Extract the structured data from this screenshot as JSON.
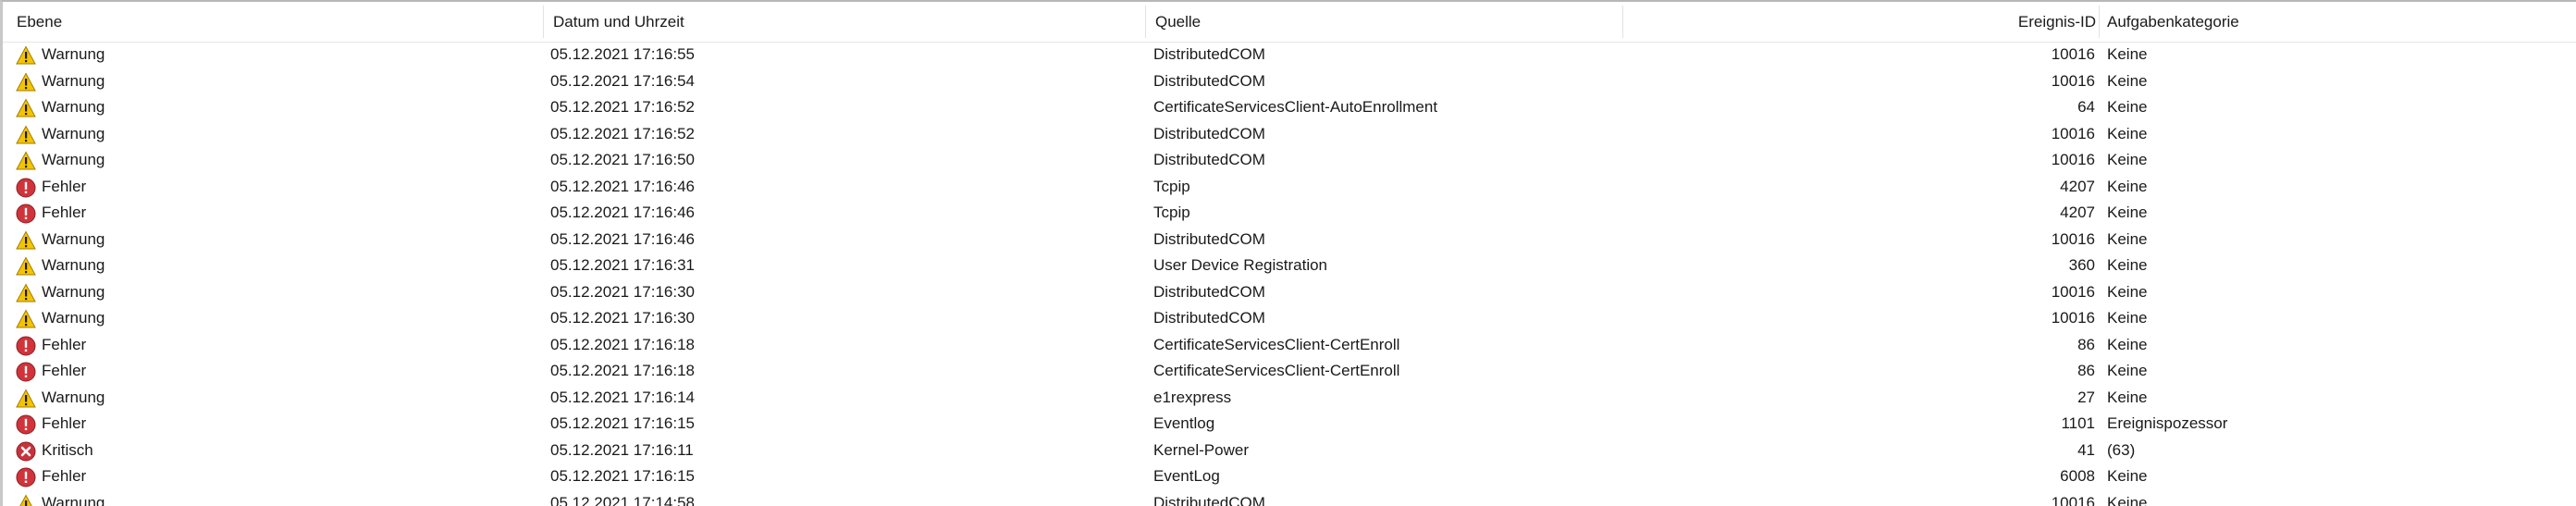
{
  "columns": {
    "level": "Ebene",
    "datetime": "Datum und Uhrzeit",
    "source": "Quelle",
    "event_id": "Ereignis-ID",
    "category": "Aufgabenkategorie"
  },
  "rows": [
    {
      "level": "Warnung",
      "icon": "warning-icon",
      "datetime": "05.12.2021 17:16:55",
      "source": "DistributedCOM",
      "event_id": "10016",
      "category": "Keine"
    },
    {
      "level": "Warnung",
      "icon": "warning-icon",
      "datetime": "05.12.2021 17:16:54",
      "source": "DistributedCOM",
      "event_id": "10016",
      "category": "Keine"
    },
    {
      "level": "Warnung",
      "icon": "warning-icon",
      "datetime": "05.12.2021 17:16:52",
      "source": "CertificateServicesClient-AutoEnrollment",
      "event_id": "64",
      "category": "Keine"
    },
    {
      "level": "Warnung",
      "icon": "warning-icon",
      "datetime": "05.12.2021 17:16:52",
      "source": "DistributedCOM",
      "event_id": "10016",
      "category": "Keine"
    },
    {
      "level": "Warnung",
      "icon": "warning-icon",
      "datetime": "05.12.2021 17:16:50",
      "source": "DistributedCOM",
      "event_id": "10016",
      "category": "Keine"
    },
    {
      "level": "Fehler",
      "icon": "error-icon",
      "datetime": "05.12.2021 17:16:46",
      "source": "Tcpip",
      "event_id": "4207",
      "category": "Keine"
    },
    {
      "level": "Fehler",
      "icon": "error-icon",
      "datetime": "05.12.2021 17:16:46",
      "source": "Tcpip",
      "event_id": "4207",
      "category": "Keine"
    },
    {
      "level": "Warnung",
      "icon": "warning-icon",
      "datetime": "05.12.2021 17:16:46",
      "source": "DistributedCOM",
      "event_id": "10016",
      "category": "Keine"
    },
    {
      "level": "Warnung",
      "icon": "warning-icon",
      "datetime": "05.12.2021 17:16:31",
      "source": "User Device Registration",
      "event_id": "360",
      "category": "Keine"
    },
    {
      "level": "Warnung",
      "icon": "warning-icon",
      "datetime": "05.12.2021 17:16:30",
      "source": "DistributedCOM",
      "event_id": "10016",
      "category": "Keine"
    },
    {
      "level": "Warnung",
      "icon": "warning-icon",
      "datetime": "05.12.2021 17:16:30",
      "source": "DistributedCOM",
      "event_id": "10016",
      "category": "Keine"
    },
    {
      "level": "Fehler",
      "icon": "error-icon",
      "datetime": "05.12.2021 17:16:18",
      "source": "CertificateServicesClient-CertEnroll",
      "event_id": "86",
      "category": "Keine"
    },
    {
      "level": "Fehler",
      "icon": "error-icon",
      "datetime": "05.12.2021 17:16:18",
      "source": "CertificateServicesClient-CertEnroll",
      "event_id": "86",
      "category": "Keine"
    },
    {
      "level": "Warnung",
      "icon": "warning-icon",
      "datetime": "05.12.2021 17:16:14",
      "source": "e1rexpress",
      "event_id": "27",
      "category": "Keine"
    },
    {
      "level": "Fehler",
      "icon": "error-icon",
      "datetime": "05.12.2021 17:16:15",
      "source": "Eventlog",
      "event_id": "1101",
      "category": "Ereignispozessor"
    },
    {
      "level": "Kritisch",
      "icon": "critical-icon",
      "datetime": "05.12.2021 17:16:11",
      "source": "Kernel-Power",
      "event_id": "41",
      "category": "(63)"
    },
    {
      "level": "Fehler",
      "icon": "error-icon",
      "datetime": "05.12.2021 17:16:15",
      "source": "EventLog",
      "event_id": "6008",
      "category": "Keine"
    },
    {
      "level": "Warnung",
      "icon": "warning-icon",
      "datetime": "05.12.2021 17:14:58",
      "source": "DistributedCOM",
      "event_id": "10016",
      "category": "Keine"
    }
  ],
  "colors": {
    "warning_fill": "#f5c400",
    "error_fill": "#d0343a",
    "critical_fill": "#c8323c"
  }
}
